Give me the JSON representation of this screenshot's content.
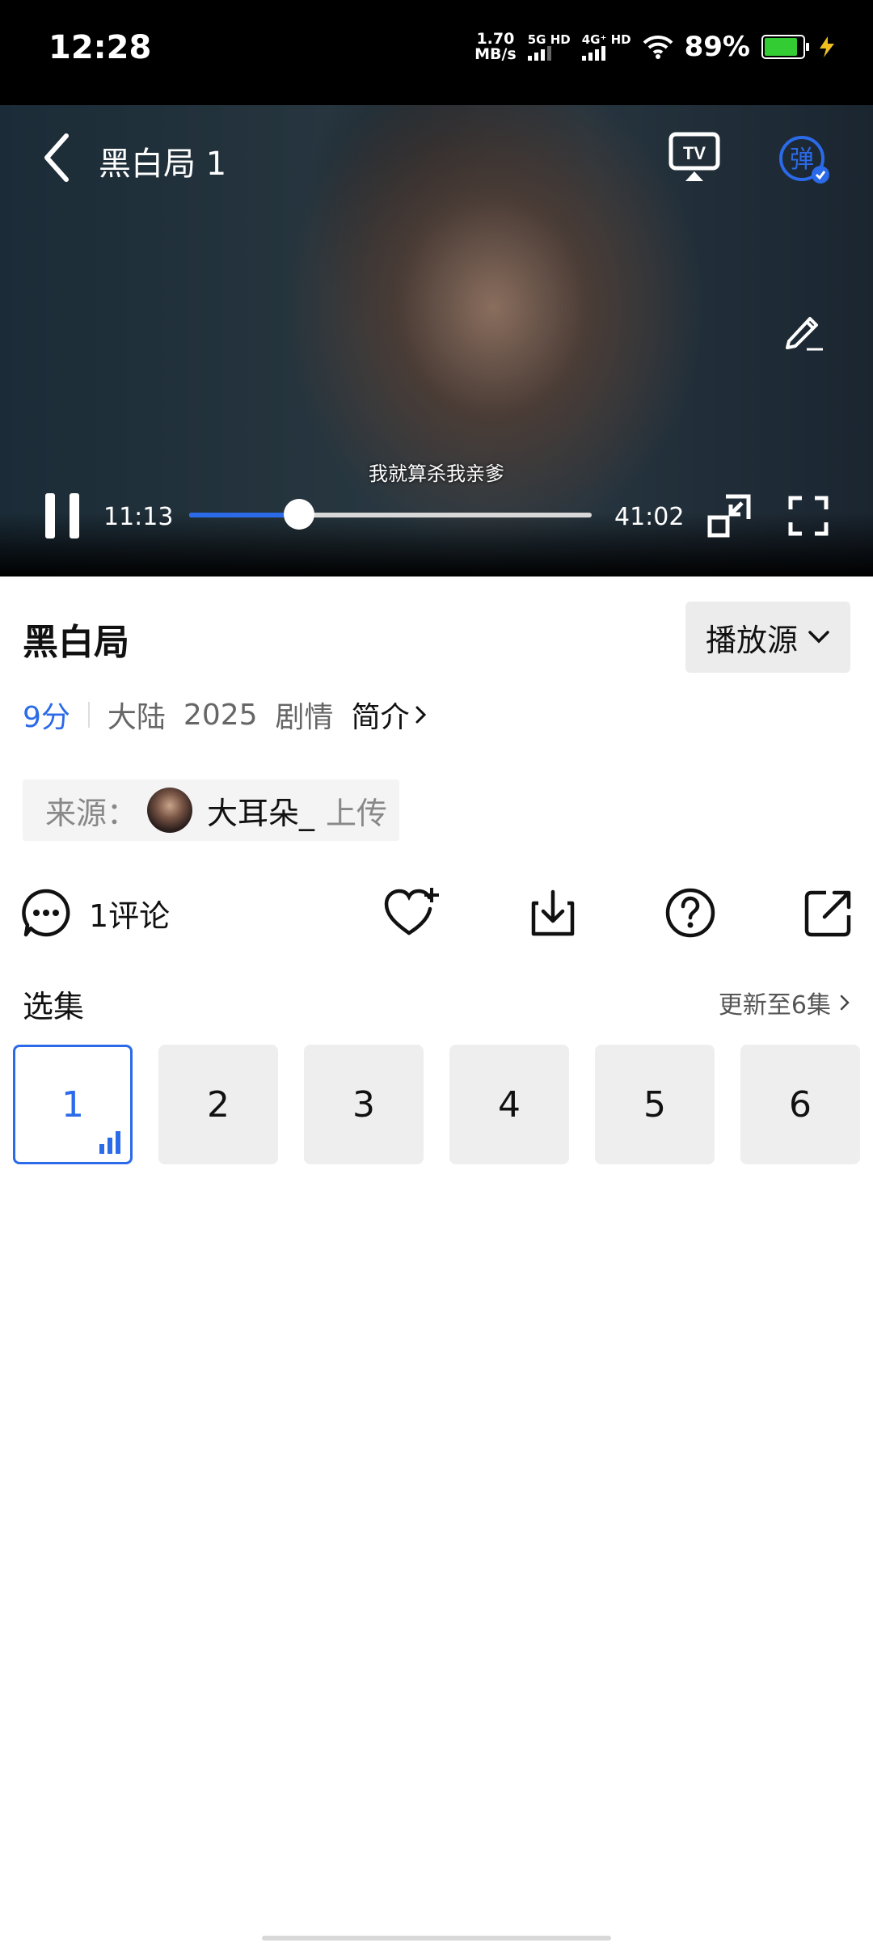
{
  "status_bar": {
    "time": "12:28",
    "net_speed_value": "1.70",
    "net_speed_unit": "MB/s",
    "sim1_label": "5G HD",
    "sim2_label": "4G⁺ HD",
    "battery": "89%",
    "battery_color": "#33cc33"
  },
  "player": {
    "title": "黑白局 1",
    "tv_label": "TV",
    "danmu_label": "弹",
    "subtitle": "我就算杀我亲爹",
    "current_time": "11:13",
    "total_time": "41:02",
    "progress": 0.273,
    "accent": "#2b6ae8"
  },
  "show": {
    "title": "黑白局",
    "source_button": "播放源",
    "score": "9分",
    "region": "大陆",
    "year": "2025",
    "genre": "剧情",
    "intro_link": "简介"
  },
  "uploader": {
    "label": "来源：",
    "name": "大耳朵_",
    "suffix": "上传"
  },
  "actions": {
    "comments": "1评论"
  },
  "episodes": {
    "title": "选集",
    "update_info": "更新至6集",
    "items": [
      "1",
      "2",
      "3",
      "4",
      "5",
      "6"
    ],
    "active_index": 0
  }
}
